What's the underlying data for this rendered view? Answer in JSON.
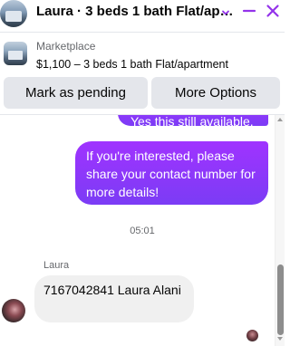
{
  "header": {
    "title": "Laura · 3 beds 1 bath Flat/apartment",
    "chevron_icon": "chevron-down-icon",
    "minimize_icon": "minimize-icon",
    "close_icon": "close-icon",
    "accent_color": "#9333ea"
  },
  "listing": {
    "source": "Marketplace",
    "description": "$1,100 – 3 beds 1 bath Flat/apartment"
  },
  "actions": {
    "mark_pending": "Mark as pending",
    "more_options": "More Options"
  },
  "thread": {
    "previous_outgoing": "Yes this still available.",
    "outgoing_message": "If you're interested, please share your contact number for more details!",
    "timestamp": "05:01",
    "sender_name": "Laura",
    "incoming_message": "7167042841 Laura Alani"
  },
  "colors": {
    "outgoing_bubble_start": "#a033ff",
    "outgoing_bubble_end": "#7b3cf5",
    "incoming_bubble": "#f0f0f0",
    "button_bg": "#e4e6eb"
  }
}
